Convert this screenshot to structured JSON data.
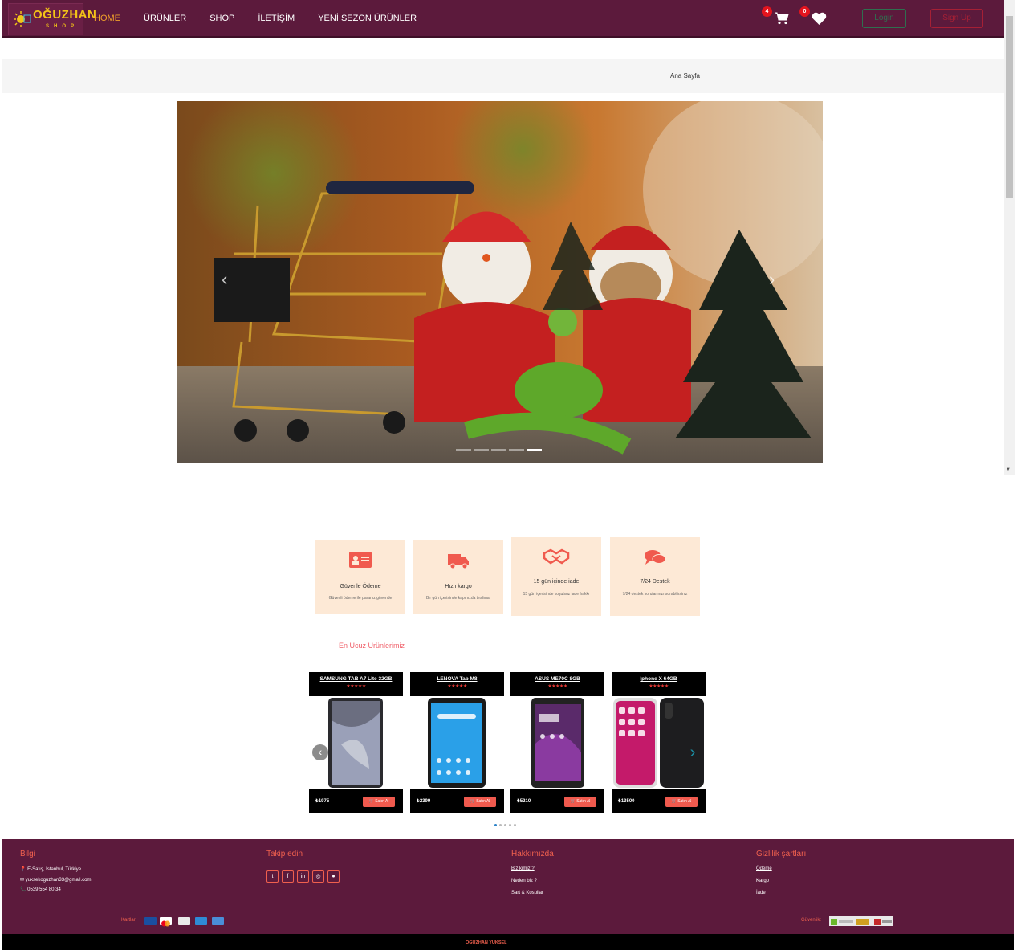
{
  "nav": {
    "logo_text": "OĞUZHAN",
    "logo_sub": "SHOP",
    "links": [
      "HOME",
      "ÜRÜNLER",
      "SHOP",
      "İLETİŞİM",
      "YENİ SEZON ÜRÜNLER"
    ],
    "active_index": 0,
    "cart_count": "4",
    "wishlist_count": "0",
    "login_label": "Login",
    "signup_label": "Sign Up",
    "bg_color": "#5c1a3c",
    "active_color": "#f0a02a"
  },
  "breadcrumb": {
    "current": "Ana Sayfa"
  },
  "hero": {
    "slide_count": 5,
    "active_slide": 4
  },
  "features": [
    {
      "icon": "id-card-icon",
      "title": "Güvenle Ödeme",
      "desc": "Güvenli ödeme ile paranız güvende"
    },
    {
      "icon": "truck-icon",
      "title": "Hızlı kargo",
      "desc": "Bir gün içerisinde kapınızda teslimat"
    },
    {
      "icon": "handshake-icon",
      "title": "15 gün içinde iade",
      "desc": "15 gün içerisinde koşulsuz iade hakkı"
    },
    {
      "icon": "chat-icon",
      "title": "7/24 Destek",
      "desc": "7/24 destek sorularınızı sorabilirsiniz"
    }
  ],
  "products_section": {
    "title": "En Ucuz Ürünlerimiz"
  },
  "products": [
    {
      "name": "SAMSUNG TAB A7 Lite 32GB",
      "price": "₺1975",
      "buy_label": "Satın Al"
    },
    {
      "name": "LENOVA Tab M8",
      "price": "₺2399",
      "buy_label": "Satın Al"
    },
    {
      "name": "ASUS ME70C 8GB",
      "price": "₺5210",
      "buy_label": "Satın Al"
    },
    {
      "name": "Iphone X 64GB",
      "price": "₺13500",
      "buy_label": "Satın Al"
    }
  ],
  "carousel": {
    "dot_count": 5,
    "active_dot": 0
  },
  "footer": {
    "info_title": "Bilgi",
    "info_address": "E-Satış, İstanbul, Türkiye",
    "info_email": "yuksekoguzhan33@gmail.com",
    "info_phone": "0539 554 80 34",
    "follow_title": "Takip edin",
    "social_icons": [
      "twitter-icon",
      "facebook-icon",
      "linkedin-icon",
      "instagram-icon",
      "android-icon"
    ],
    "about_title": "Hakkımızda",
    "about_links": [
      "Biz kimiz ?",
      "Neden biz ?",
      "Sart & Kosullar"
    ],
    "privacy_title": "Gizlilik şartları",
    "privacy_links": [
      "Ödeme",
      "Kargo",
      "İade"
    ],
    "cards_label": "Kartlar:",
    "security_label": "Güvenlik:",
    "copyright": "OĞUZHAN YÜKSEL",
    "bg_color": "#5c1a3c",
    "accent_color": "#f0604e"
  }
}
